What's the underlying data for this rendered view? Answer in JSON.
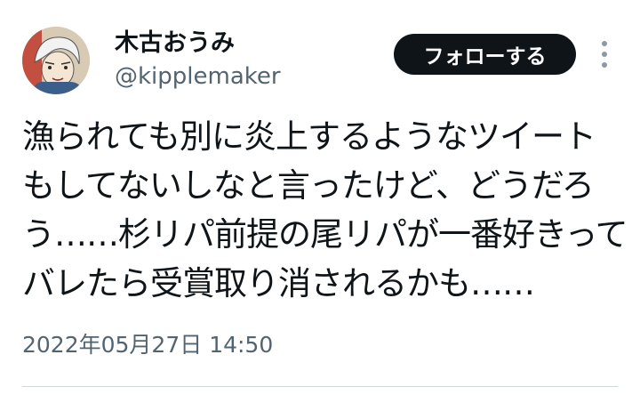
{
  "author": {
    "display_name": "木古おうみ",
    "handle": "@kipplemaker"
  },
  "actions": {
    "follow_label": "フォローする"
  },
  "tweet": {
    "lines": [
      "漁られても別に炎上するようなツイート",
      "もしてないしなと言ったけど、どうだろ",
      "う……杉リパ前提の尾リパが一番好きって",
      "バレたら受賞取り消されるかも……"
    ],
    "timestamp": "2022年05月27日 14:50"
  },
  "icons": {
    "more": "more-vertical-icon",
    "avatar": "avatar-illustration"
  },
  "colors": {
    "text": "#0f1419",
    "secondary_text": "#536471",
    "follow_button_bg": "#0f1419",
    "follow_button_text": "#ffffff",
    "divider": "#cfd9de"
  }
}
